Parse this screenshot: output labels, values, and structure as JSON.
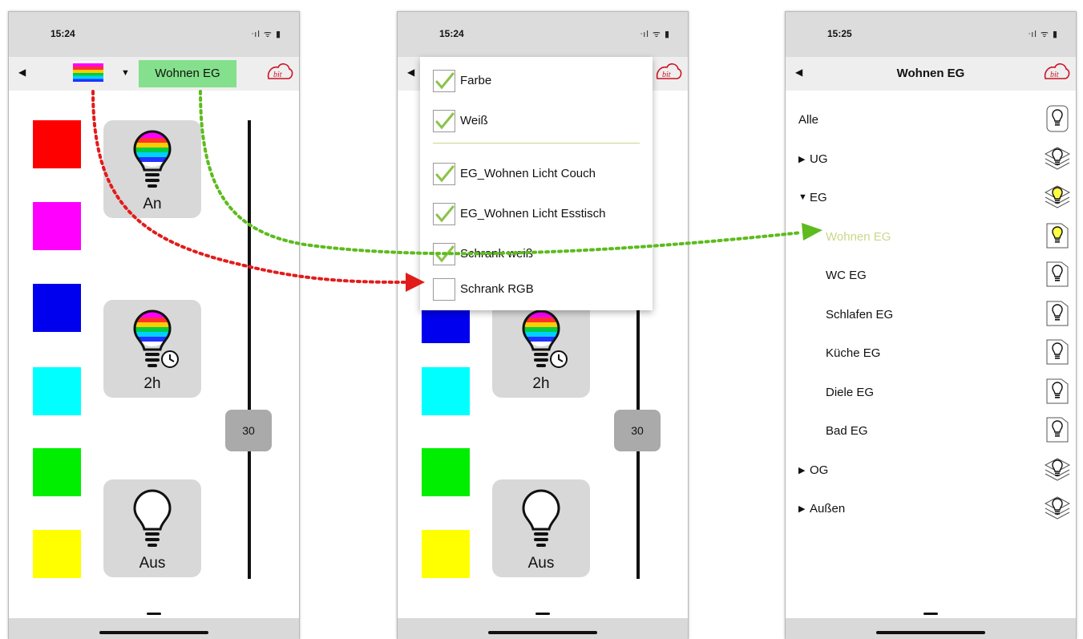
{
  "phone1": {
    "time": "15:24",
    "room": "Wohnen EG",
    "swatches": [
      "#ff0000",
      "#ff00ff",
      "#0000ee",
      "#00ffff",
      "#00ee00",
      "#ffff00"
    ],
    "tiles": [
      "An",
      "2h",
      "Aus"
    ],
    "slider_value": "30"
  },
  "phone2": {
    "time": "15:24",
    "menu": [
      {
        "label": "Farbe",
        "checked": true
      },
      {
        "label": "Weiß",
        "checked": true
      },
      {
        "label": "EG_Wohnen Licht Couch",
        "checked": true
      },
      {
        "label": "EG_Wohnen Licht Esstisch",
        "checked": true
      },
      {
        "label": "Schrank weiß",
        "checked": true
      },
      {
        "label": "Schrank RGB",
        "checked": false
      }
    ],
    "tiles": [
      "2h",
      "Aus"
    ],
    "slider_value": "30"
  },
  "phone3": {
    "time": "15:25",
    "title": "Wohnen EG",
    "tree": [
      {
        "label": "Alle",
        "indent": 0,
        "arrow": "",
        "active": false,
        "highlight": false
      },
      {
        "label": "UG",
        "indent": 0,
        "arrow": "▶",
        "active": false,
        "highlight": false
      },
      {
        "label": "EG",
        "indent": 0,
        "arrow": "▼",
        "active": true,
        "highlight": false
      },
      {
        "label": "Wohnen EG",
        "indent": 1,
        "arrow": "",
        "active": true,
        "highlight": true
      },
      {
        "label": "WC EG",
        "indent": 1,
        "arrow": "",
        "active": false,
        "highlight": false
      },
      {
        "label": "Schlafen EG",
        "indent": 1,
        "arrow": "",
        "active": false,
        "highlight": false
      },
      {
        "label": "Küche EG",
        "indent": 1,
        "arrow": "",
        "active": false,
        "highlight": false
      },
      {
        "label": "Diele EG",
        "indent": 1,
        "arrow": "",
        "active": false,
        "highlight": false
      },
      {
        "label": "Bad EG",
        "indent": 1,
        "arrow": "",
        "active": false,
        "highlight": false
      },
      {
        "label": "OG",
        "indent": 0,
        "arrow": "▶",
        "active": false,
        "highlight": false
      },
      {
        "label": "Außen",
        "indent": 0,
        "arrow": "▶",
        "active": false,
        "highlight": false
      }
    ]
  },
  "icons": {
    "back": "◀",
    "dropdown": "▼",
    "status": "ᐧıl ᯤ ▮"
  },
  "colors": {
    "arrow_red": "#e21b1b",
    "arrow_green": "#5dbb1d",
    "highlight_text": "#c8d88a",
    "room_chip": "#84e08c",
    "bulb_active": "#ffff44"
  }
}
